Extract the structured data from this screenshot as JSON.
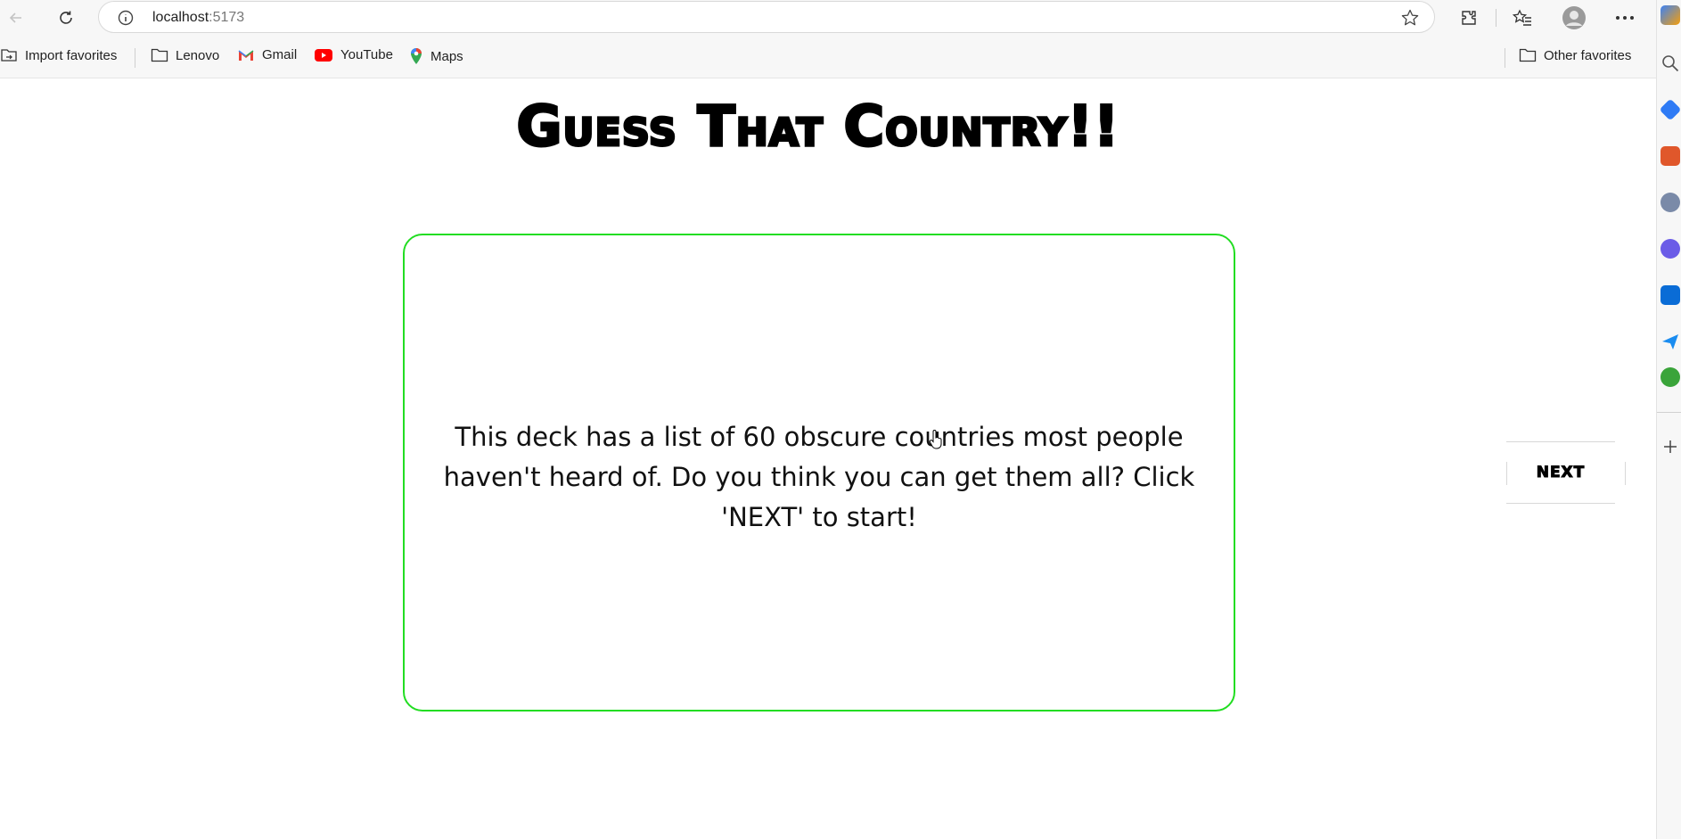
{
  "browser": {
    "url_host": "localhost",
    "url_port": ":5173",
    "bookmarks": [
      {
        "label": "Import favorites",
        "icon": "import-icon"
      },
      {
        "label": "Lenovo",
        "icon": "folder-icon"
      },
      {
        "label": "Gmail",
        "icon": "gmail-icon"
      },
      {
        "label": "YouTube",
        "icon": "youtube-icon"
      },
      {
        "label": "Maps",
        "icon": "maps-icon"
      }
    ],
    "other_favorites": "Other favorites"
  },
  "page": {
    "title": "Guess That Country!!",
    "card_text": "This deck has a list of 60 obscure countries most people haven't heard of. Do you think you can get them all? Click 'NEXT' to start!",
    "next_label": "NEXT"
  },
  "colors": {
    "card_border": "#22dd22",
    "title": "#000000"
  }
}
